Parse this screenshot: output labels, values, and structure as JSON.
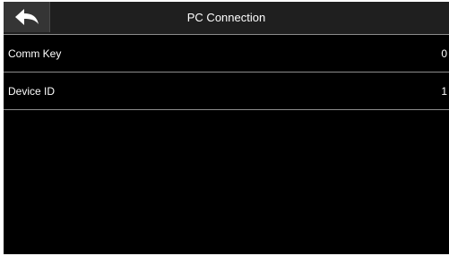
{
  "header": {
    "title": "PC Connection",
    "back_icon": "back-arrow-icon"
  },
  "menu": {
    "items": [
      {
        "label": "Comm Key",
        "value": "0"
      },
      {
        "label": "Device ID",
        "value": "1"
      }
    ]
  },
  "colors": {
    "background": "#000000",
    "header_background": "#1f1f1f",
    "back_button_background": "#353535",
    "divider": "#8c8c8c",
    "text": "#ffffff"
  }
}
